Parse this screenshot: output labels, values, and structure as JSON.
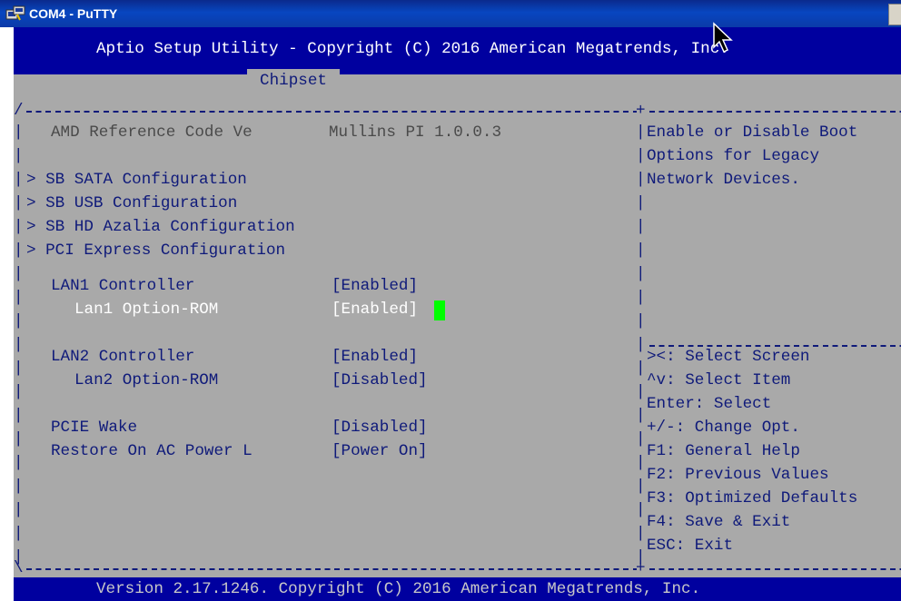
{
  "window": {
    "title": "COM4 - PuTTY"
  },
  "bios": {
    "header": "Aptio Setup Utility - Copyright (C) 2016 American Megatrends, Inc.",
    "active_tab": "Chipset",
    "footer": "Version 2.17.1246. Copyright (C) 2016 American Megatrends, Inc.",
    "info": {
      "label": "AMD Reference Code Ve",
      "value": "Mullins PI 1.0.0.3"
    },
    "submenus": [
      "SB SATA Configuration",
      "SB USB Configuration",
      "SB HD Azalia Configuration",
      "PCI Express Configuration"
    ],
    "submenu_marker": ">",
    "settings": [
      {
        "label": "LAN1 Controller",
        "value": "[Enabled]"
      },
      {
        "label": "Lan1 Option-ROM",
        "value": "[Enabled]"
      },
      {
        "label": "LAN2 Controller",
        "value": "[Enabled]"
      },
      {
        "label": "Lan2 Option-ROM",
        "value": "[Disabled]"
      },
      {
        "label": "PCIE Wake",
        "value": "[Disabled]"
      },
      {
        "label": "Restore On AC Power L",
        "value": "[Power On]"
      }
    ],
    "help": [
      "Enable or Disable Boot",
      "Options for Legacy",
      "Network Devices."
    ],
    "keys": [
      "><: Select Screen",
      "^v: Select Item",
      "Enter: Select",
      "+/-: Change Opt.",
      "F1: General Help",
      "F2: Previous Values",
      "F3: Optimized Defaults",
      "F4: Save & Exit",
      "ESC: Exit"
    ]
  },
  "colors": {
    "header_bg": "#00009f",
    "terminal_bg": "#a9a9a9",
    "text": "#0f1a7a",
    "highlight": "#ffffff",
    "cursor": "#00ff00"
  }
}
